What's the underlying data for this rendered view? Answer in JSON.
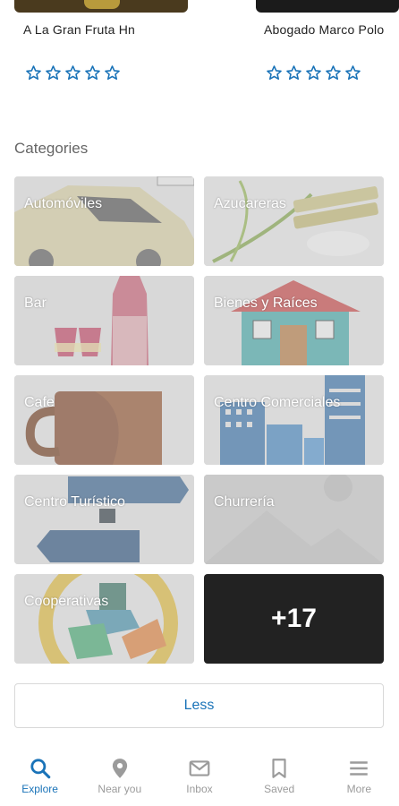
{
  "top_cards": [
    {
      "title": "A La Gran Fruta Hn",
      "rating_stars": 5
    },
    {
      "title": "Abogado Marco Polo",
      "rating_stars": 5
    }
  ],
  "categories_section": {
    "title": "Categories",
    "items": [
      {
        "label": "Automóviles",
        "icon": "car-image"
      },
      {
        "label": "Azucareras",
        "icon": "sugarcane-image"
      },
      {
        "label": "Bar",
        "icon": "wine-bottle-image"
      },
      {
        "label": "Bienes y Raíces",
        "icon": "house-image"
      },
      {
        "label": "Cafe",
        "icon": "coffee-mug-image"
      },
      {
        "label": "Centro Comerciales",
        "icon": "buildings-image"
      },
      {
        "label": "Centro Turístico",
        "icon": "signpost-image"
      },
      {
        "label": "Churrería",
        "icon": "placeholder-image"
      },
      {
        "label": "Cooperativas",
        "icon": "hands-circle-image"
      }
    ],
    "more_label": "+17",
    "toggle_label": "Less"
  },
  "bottom_nav": {
    "items": [
      {
        "label": "Explore",
        "icon": "search-icon",
        "active": true
      },
      {
        "label": "Near you",
        "icon": "location-pin-icon",
        "active": false
      },
      {
        "label": "Inbox",
        "icon": "mail-icon",
        "active": false
      },
      {
        "label": "Saved",
        "icon": "bookmark-icon",
        "active": false
      },
      {
        "label": "More",
        "icon": "menu-icon",
        "active": false
      }
    ]
  },
  "colors": {
    "accent": "#1a73b8",
    "inactive": "#9b9b9b",
    "star": "#1a73b8"
  }
}
